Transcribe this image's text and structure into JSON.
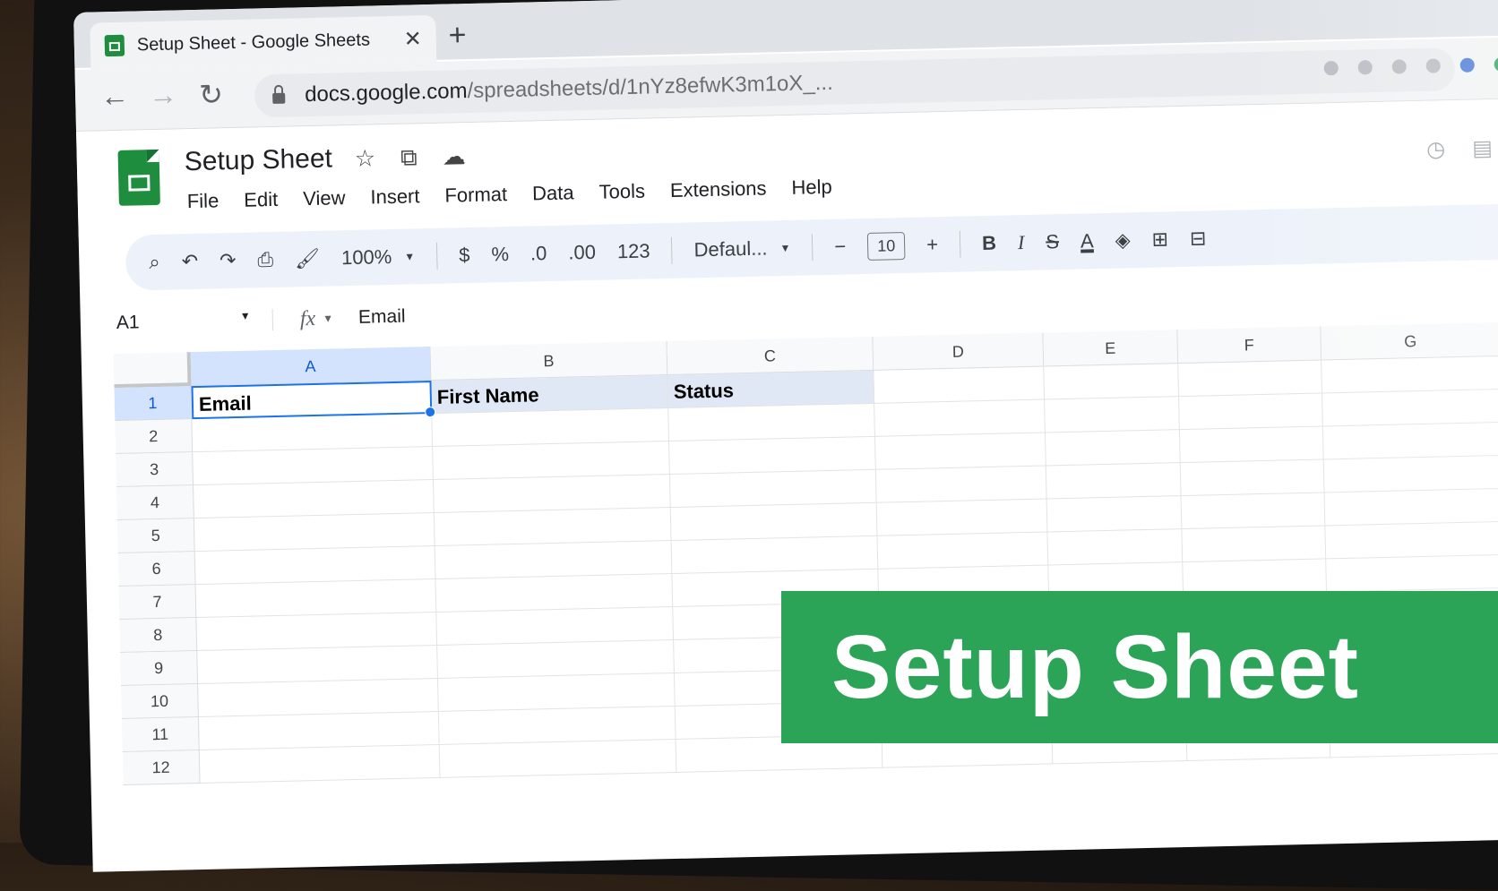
{
  "browser": {
    "tab_title": "Setup Sheet - Google Sheets",
    "tab_close": "✕",
    "new_tab": "+",
    "url_host": "docs.google.com",
    "url_path": "/spreadsheets/d/1nYz8efwK3m1oX_..."
  },
  "app": {
    "title": "Setup Sheet",
    "menu": [
      "File",
      "Edit",
      "View",
      "Insert",
      "Format",
      "Data",
      "Tools",
      "Extensions",
      "Help"
    ]
  },
  "toolbar": {
    "zoom": "100%",
    "currency": "$",
    "percent": "%",
    "decrease_decimal": ".0",
    "increase_decimal": ".00",
    "more_formats": "123",
    "font": "Defaul...",
    "font_size_minus": "−",
    "font_size": "10",
    "font_size_plus": "+",
    "bold": "B",
    "italic": "I",
    "strike": "S",
    "text_color": "A"
  },
  "formula_bar": {
    "name_box": "A1",
    "fx": "fx",
    "value": "Email"
  },
  "grid": {
    "columns": [
      "A",
      "B",
      "C",
      "D",
      "E",
      "F",
      "G"
    ],
    "rows": [
      "1",
      "2",
      "3",
      "4",
      "5",
      "6",
      "7",
      "8",
      "9",
      "10",
      "11",
      "12"
    ],
    "row1": [
      "Email",
      "First Name",
      "Status"
    ]
  },
  "overlay": {
    "banner_text": "Setup Sheet"
  },
  "colors": {
    "sheets_green": "#1e8e3e",
    "banner_green": "#2ba457",
    "selection_blue": "#1a73e8"
  }
}
